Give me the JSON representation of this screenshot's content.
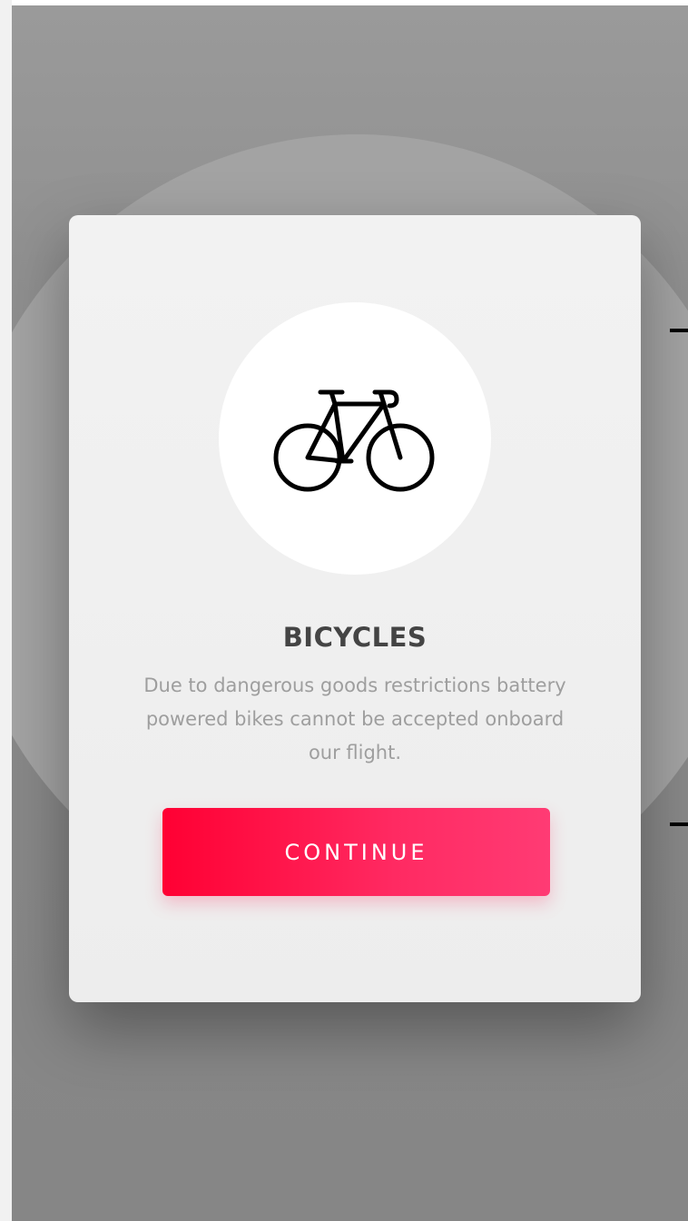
{
  "dialog": {
    "title": "BICYCLES",
    "message": "Due to dangerous goods restrictions battery powered bikes cannot be accepted onboard our flight.",
    "continue_label": "CONTINUE",
    "icon": "bicycle-icon"
  },
  "colors": {
    "accent": "#ff1f4f",
    "title": "#444444",
    "message": "#9e9e9e",
    "card": "#f0f0f0",
    "overlay": "#8a8a8a"
  }
}
